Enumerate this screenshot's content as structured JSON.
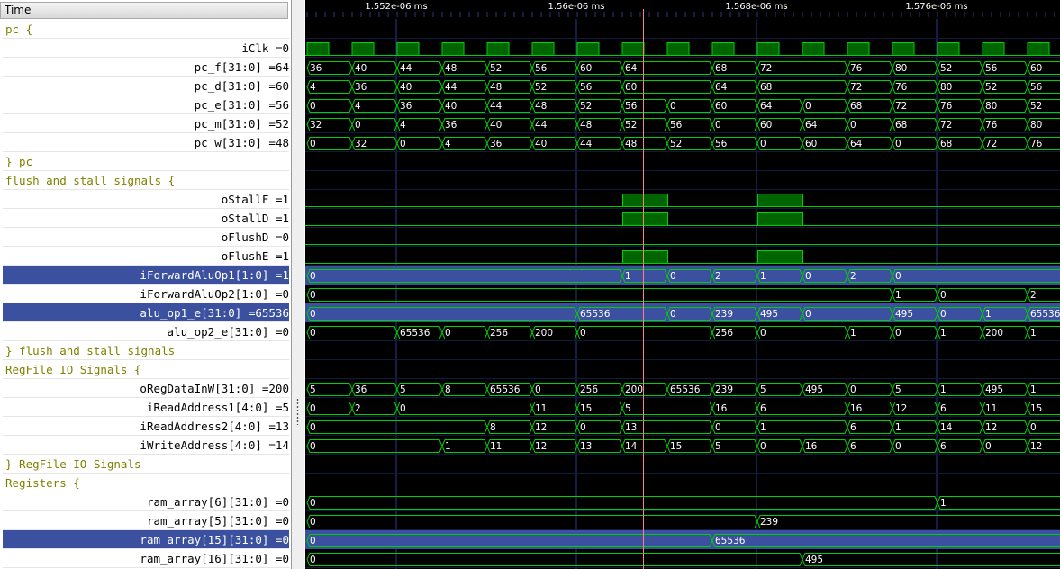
{
  "time_header": "Time",
  "timeline": {
    "tick_labels": [
      "1.552e-06 ms",
      "1.56e-06 ms",
      "1.568e-06 ms",
      "1.576e-06 ms"
    ]
  },
  "rows": [
    {
      "kind": "group",
      "label": "pc {"
    },
    {
      "kind": "signal",
      "label": "iClk =0",
      "wave": {
        "type": "clock"
      }
    },
    {
      "kind": "signal",
      "label": "pc_f[31:0] =64",
      "wave": {
        "type": "bus",
        "values": [
          "36",
          "40",
          "44",
          "48",
          "52",
          "56",
          "60",
          "64",
          "",
          "68",
          "72",
          "",
          "76",
          "80",
          "52",
          "56",
          "60"
        ]
      }
    },
    {
      "kind": "signal",
      "label": "pc_d[31:0] =60",
      "wave": {
        "type": "bus",
        "values": [
          "4",
          "36",
          "40",
          "44",
          "48",
          "52",
          "56",
          "60",
          "",
          "64",
          "68",
          "",
          "72",
          "76",
          "80",
          "52",
          "56"
        ]
      }
    },
    {
      "kind": "signal",
      "label": "pc_e[31:0] =56",
      "wave": {
        "type": "bus",
        "values": [
          "0",
          "4",
          "36",
          "40",
          "44",
          "48",
          "52",
          "56",
          "0",
          "60",
          "64",
          "0",
          "68",
          "72",
          "76",
          "80",
          "52"
        ]
      }
    },
    {
      "kind": "signal",
      "label": "pc_m[31:0] =52",
      "wave": {
        "type": "bus",
        "values": [
          "32",
          "0",
          "4",
          "36",
          "40",
          "44",
          "48",
          "52",
          "56",
          "0",
          "60",
          "64",
          "0",
          "68",
          "72",
          "76",
          "80"
        ]
      }
    },
    {
      "kind": "signal",
      "label": "pc_w[31:0] =48",
      "wave": {
        "type": "bus",
        "values": [
          "0",
          "32",
          "0",
          "4",
          "36",
          "40",
          "44",
          "48",
          "52",
          "56",
          "0",
          "60",
          "64",
          "0",
          "68",
          "72",
          "76"
        ]
      }
    },
    {
      "kind": "group",
      "label": "} pc"
    },
    {
      "kind": "group",
      "label": "flush and stall signals {"
    },
    {
      "kind": "signal",
      "label": "oStallF =1",
      "wave": {
        "type": "bit",
        "highs": [
          7,
          10
        ]
      }
    },
    {
      "kind": "signal",
      "label": "oStallD =1",
      "wave": {
        "type": "bit",
        "highs": [
          7,
          10
        ]
      }
    },
    {
      "kind": "signal",
      "label": "oFlushD =0",
      "wave": {
        "type": "bit",
        "highs": []
      }
    },
    {
      "kind": "signal",
      "label": "oFlushE =1",
      "wave": {
        "type": "bit",
        "highs": [
          7,
          10
        ]
      }
    },
    {
      "kind": "signal",
      "label": "iForwardAluOp1[1:0] =1",
      "selected": true,
      "wave": {
        "type": "bus",
        "values": [
          "0",
          "",
          "",
          "",
          "",
          "",
          "",
          "1",
          "0",
          "2",
          "1",
          "0",
          "2",
          "0",
          "",
          "",
          ""
        ]
      }
    },
    {
      "kind": "signal",
      "label": "iForwardAluOp2[1:0] =0",
      "wave": {
        "type": "bus",
        "values": [
          "0",
          "",
          "",
          "",
          "",
          "",
          "",
          "",
          "",
          "",
          "",
          "",
          "",
          "1",
          "0",
          "",
          "2"
        ]
      }
    },
    {
      "kind": "signal",
      "label": "alu_op1_e[31:0] =65536",
      "selected": true,
      "wave": {
        "type": "bus",
        "values": [
          "0",
          "",
          "",
          "",
          "",
          "",
          "65536",
          "",
          "0",
          "239",
          "495",
          "0",
          "",
          "495",
          "0",
          "1",
          "65536"
        ]
      }
    },
    {
      "kind": "signal",
      "label": "alu_op2_e[31:0] =0",
      "wave": {
        "type": "bus",
        "values": [
          "0",
          "",
          "65536",
          "0",
          "256",
          "200",
          "0",
          "",
          "",
          "256",
          "0",
          "",
          "1",
          "0",
          "1",
          "200",
          "1"
        ]
      }
    },
    {
      "kind": "group",
      "label": "} flush and stall signals"
    },
    {
      "kind": "group",
      "label": "RegFile IO Signals {"
    },
    {
      "kind": "signal",
      "label": "oRegDataInW[31:0] =200",
      "wave": {
        "type": "bus",
        "values": [
          "5",
          "36",
          "5",
          "8",
          "65536",
          "0",
          "256",
          "200",
          "65536",
          "239",
          "5",
          "495",
          "0",
          "5",
          "1",
          "495",
          "1"
        ]
      }
    },
    {
      "kind": "signal",
      "label": "iReadAddress1[4:0] =5",
      "wave": {
        "type": "bus",
        "values": [
          "0",
          "2",
          "0",
          "",
          "",
          "11",
          "15",
          "5",
          "",
          "16",
          "6",
          "",
          "16",
          "12",
          "6",
          "11",
          "15"
        ]
      }
    },
    {
      "kind": "signal",
      "label": "iReadAddress2[4:0] =13",
      "wave": {
        "type": "bus",
        "values": [
          "0",
          "",
          "",
          "",
          "8",
          "12",
          "0",
          "13",
          "",
          "0",
          "1",
          "",
          "6",
          "1",
          "14",
          "12",
          "0"
        ]
      }
    },
    {
      "kind": "signal",
      "label": "iWriteAddress[4:0] =14",
      "wave": {
        "type": "bus",
        "values": [
          "0",
          "",
          "",
          "1",
          "11",
          "12",
          "13",
          "14",
          "15",
          "5",
          "0",
          "16",
          "6",
          "0",
          "6",
          "0",
          "12"
        ]
      }
    },
    {
      "kind": "group",
      "label": "} RegFile IO Signals"
    },
    {
      "kind": "group",
      "label": "Registers {"
    },
    {
      "kind": "signal",
      "label": "ram_array[6][31:0] =0",
      "wave": {
        "type": "bus",
        "values": [
          "0",
          "",
          "",
          "",
          "",
          "",
          "",
          "",
          "",
          "",
          "",
          "",
          "",
          "",
          "1",
          "",
          ""
        ]
      }
    },
    {
      "kind": "signal",
      "label": "ram_array[5][31:0] =0",
      "wave": {
        "type": "bus",
        "values": [
          "0",
          "",
          "",
          "",
          "",
          "",
          "",
          "",
          "",
          "",
          "239",
          "",
          "",
          "",
          "",
          "",
          ""
        ]
      }
    },
    {
      "kind": "signal",
      "label": "ram_array[15][31:0] =0",
      "selected": true,
      "wave": {
        "type": "bus",
        "values": [
          "0",
          "",
          "",
          "",
          "",
          "",
          "",
          "",
          "",
          "65536",
          "",
          "",
          "",
          "",
          "",
          "",
          ""
        ]
      }
    },
    {
      "kind": "signal",
      "label": "ram_array[16][31:0] =0",
      "wave": {
        "type": "bus",
        "values": [
          "0",
          "",
          "",
          "",
          "",
          "",
          "",
          "",
          "",
          "",
          "",
          "495",
          "",
          "",
          "",
          "",
          ""
        ]
      }
    }
  ],
  "colors": {
    "wave": "#00d000",
    "clock_fill": "#006400",
    "selected_row": "#3b51a0",
    "group_text": "#808000",
    "cursor": "#ff8080",
    "grid": "#2a3a8a"
  }
}
